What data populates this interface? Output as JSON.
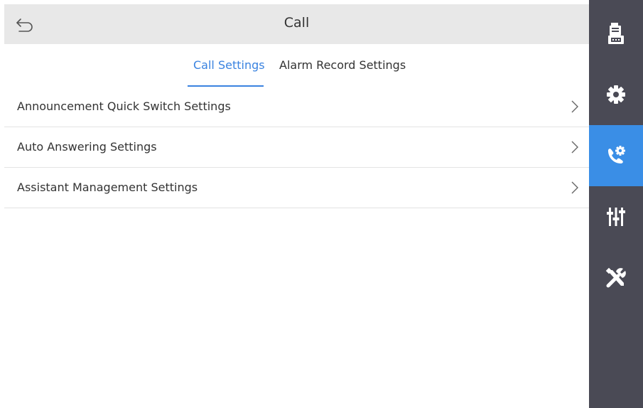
{
  "header": {
    "title": "Call"
  },
  "tabs": [
    {
      "label": "Call Settings",
      "active": true
    },
    {
      "label": "Alarm Record Settings",
      "active": false
    }
  ],
  "settings_list": [
    {
      "label": "Announcement Quick Switch Settings"
    },
    {
      "label": "Auto Answering Settings"
    },
    {
      "label": "Assistant Management Settings"
    }
  ],
  "sidebar": {
    "items": [
      {
        "icon": "intercom-device-icon",
        "active": false
      },
      {
        "icon": "gear-icon",
        "active": false
      },
      {
        "icon": "call-settings-icon",
        "active": true
      },
      {
        "icon": "sliders-icon",
        "active": false
      },
      {
        "icon": "tools-icon",
        "active": false
      }
    ]
  },
  "colors": {
    "accent": "#3a83e0",
    "sidebar_bg": "#4a4a55",
    "sidebar_active": "#3a8ee6",
    "header_bg": "#e8e8e8"
  }
}
